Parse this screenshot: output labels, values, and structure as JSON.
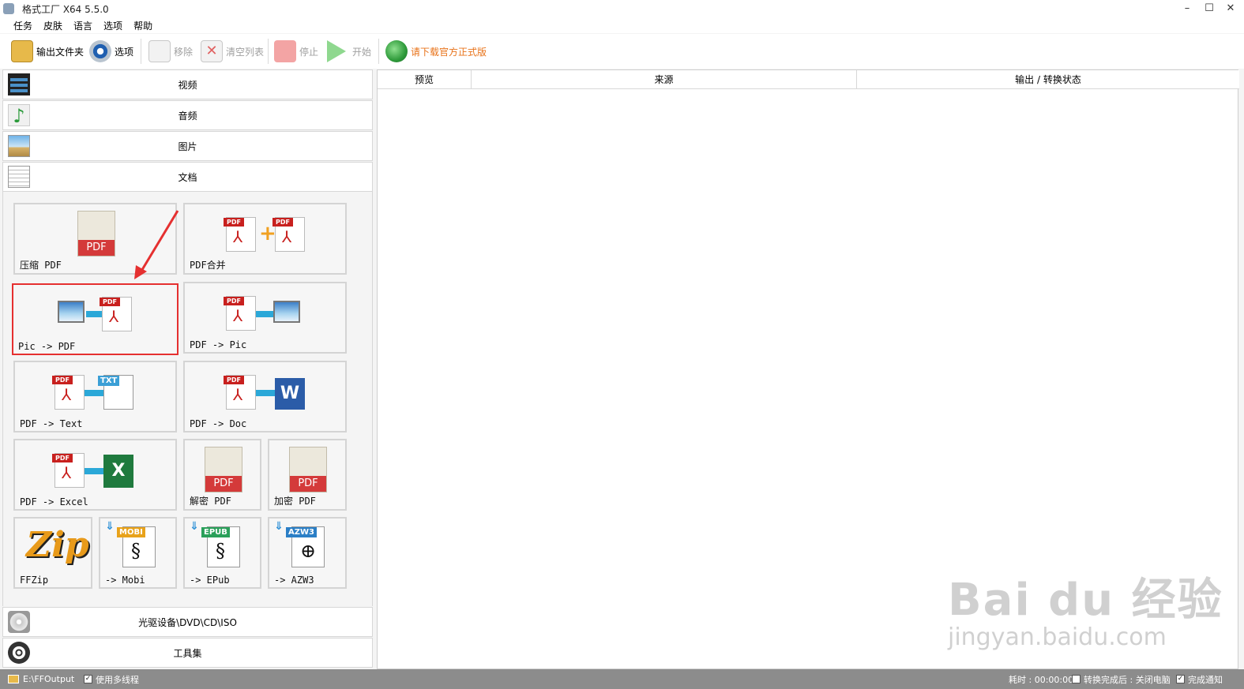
{
  "window": {
    "title": "格式工厂 X64 5.5.0",
    "min_glyph": "–",
    "max_glyph": "☐",
    "close_glyph": "✕"
  },
  "menu": [
    "任务",
    "皮肤",
    "语言",
    "选项",
    "帮助"
  ],
  "toolbar": {
    "output_folder": "输出文件夹",
    "options": "选项",
    "remove": "移除",
    "clear_list": "清空列表",
    "stop": "停止",
    "start": "开始",
    "download_official": "请下载官方正式版"
  },
  "categories": {
    "video": "视频",
    "audio": "音频",
    "picture": "图片",
    "document": "文档",
    "optical": "光驱设备\\DVD\\CD\\ISO",
    "toolbox": "工具集"
  },
  "tiles": {
    "compress_pdf": "压缩 PDF",
    "pdf_merge": "PDF合并",
    "pic_to_pdf": "Pic -> PDF",
    "pdf_to_pic": "PDF -> Pic",
    "pdf_to_text": "PDF -> Text",
    "pdf_to_doc": "PDF -> Doc",
    "pdf_to_excel": "PDF -> Excel",
    "decrypt_pdf": "解密 PDF",
    "encrypt_pdf": "加密 PDF",
    "ffzip": "FFZip",
    "to_mobi": "-> Mobi",
    "to_epub": "-> EPub",
    "to_azw3": "-> AZW3"
  },
  "icon_badges": {
    "pdf": "PDF",
    "txt": "TXT",
    "word": "W",
    "excel": "X",
    "mobi": "MOBI",
    "epub": "EPUB",
    "azw3": "AZW3",
    "zip": "Zip",
    "plus": "+",
    "download": "⇓"
  },
  "list_columns": [
    "预览",
    "来源",
    "输出 / 转换状态"
  ],
  "status": {
    "output_path": "E:\\FFOutput",
    "multithread_label": "使用多线程",
    "multithread_checked": true,
    "elapsed": "耗时 : 00:00:00",
    "after_convert_checked": false,
    "after_convert_label": "转换完成后 : 关闭电脑",
    "notify_checked": true,
    "notify_label": "完成通知"
  },
  "watermark": {
    "main": "Bai du 经验",
    "sub": "jingyan.baidu.com"
  },
  "colors": {
    "selected_border": "#e53030",
    "accent_orange": "#e8731a",
    "pdf_red": "#c8201e",
    "status_bar": "#8c8c8c"
  }
}
